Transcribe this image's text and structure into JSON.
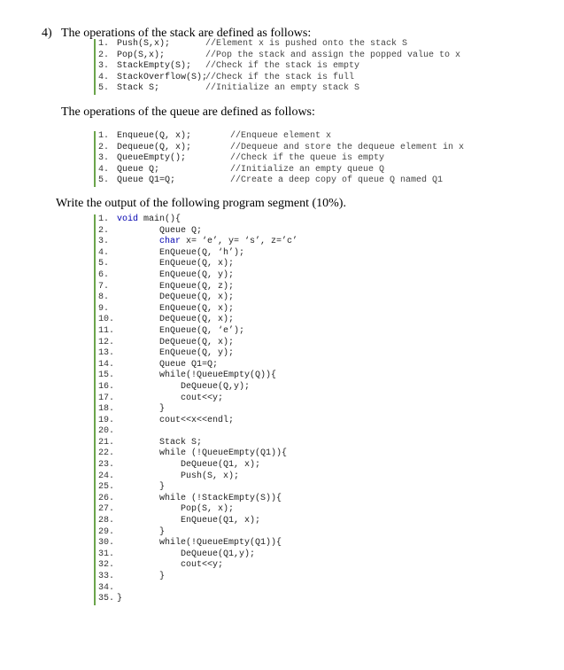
{
  "question": {
    "number": "4)",
    "stack_intro": "The operations of the stack are defined as follows:",
    "queue_intro": "The operations of the queue are defined as follows:",
    "task": "Write the output of the following program segment (10%)."
  },
  "stack_ops": [
    {
      "num": "1.",
      "code": "Push(S,x);",
      "comment": "//Element x is pushed onto the stack S"
    },
    {
      "num": "2.",
      "code": "Pop(S,x);",
      "comment": "//Pop the stack and assign the popped value to x"
    },
    {
      "num": "3.",
      "code": "StackEmpty(S);",
      "comment": "//Check if the stack is empty"
    },
    {
      "num": "4.",
      "code": "StackOverflow(S);",
      "comment": "//Check if the stack is full"
    },
    {
      "num": "5.",
      "code": "Stack S;",
      "comment": "//Initialize an empty stack S"
    }
  ],
  "queue_ops": [
    {
      "num": "1.",
      "code": "Enqueue(Q, x);",
      "comment": "//Enqueue element x"
    },
    {
      "num": "2.",
      "code": "Dequeue(Q, x);",
      "comment": "//Dequeue and store the dequeue element in x"
    },
    {
      "num": "3.",
      "code": "QueueEmpty();",
      "comment": "//Check if the queue is empty"
    },
    {
      "num": "4.",
      "code": "Queue Q;",
      "comment": "//Initialize an empty queue Q"
    },
    {
      "num": "5.",
      "code": "Queue Q1=Q;",
      "comment": "//Create a deep copy of queue Q named Q1"
    }
  ],
  "program": [
    {
      "num": "1.",
      "kw": "void",
      "text": " main(){"
    },
    {
      "num": "2.",
      "kw": "",
      "text": "        Queue Q;"
    },
    {
      "num": "3.",
      "kw": "        char",
      "text": " x= ‘e’, y= ‘s’, z=’c’"
    },
    {
      "num": "4.",
      "kw": "",
      "text": "        EnQueue(Q, ‘h’);"
    },
    {
      "num": "5.",
      "kw": "",
      "text": "        EnQueue(Q, x);"
    },
    {
      "num": "6.",
      "kw": "",
      "text": "        EnQueue(Q, y);"
    },
    {
      "num": "7.",
      "kw": "",
      "text": "        EnQueue(Q, z);"
    },
    {
      "num": "8.",
      "kw": "",
      "text": "        DeQueue(Q, x);"
    },
    {
      "num": "9.",
      "kw": "",
      "text": "        EnQueue(Q, x);"
    },
    {
      "num": "10.",
      "kw": "",
      "text": "        DeQueue(Q, x);"
    },
    {
      "num": "11.",
      "kw": "",
      "text": "        EnQueue(Q, ‘e’);"
    },
    {
      "num": "12.",
      "kw": "",
      "text": "        DeQueue(Q, x);"
    },
    {
      "num": "13.",
      "kw": "",
      "text": "        EnQueue(Q, y);"
    },
    {
      "num": "14.",
      "kw": "",
      "text": "        Queue Q1=Q;"
    },
    {
      "num": "15.",
      "kw": "",
      "text": "        while(!QueueEmpty(Q)){"
    },
    {
      "num": "16.",
      "kw": "",
      "text": "            DeQueue(Q,y);"
    },
    {
      "num": "17.",
      "kw": "",
      "text": "            cout<<y;"
    },
    {
      "num": "18.",
      "kw": "",
      "text": "        }"
    },
    {
      "num": "19.",
      "kw": "",
      "text": "        cout<<x<<endl;"
    },
    {
      "num": "20.",
      "kw": "",
      "text": ""
    },
    {
      "num": "21.",
      "kw": "",
      "text": "        Stack S;"
    },
    {
      "num": "22.",
      "kw": "",
      "text": "        while (!QueueEmpty(Q1)){"
    },
    {
      "num": "23.",
      "kw": "",
      "text": "            DeQueue(Q1, x);"
    },
    {
      "num": "24.",
      "kw": "",
      "text": "            Push(S, x);"
    },
    {
      "num": "25.",
      "kw": "",
      "text": "        }"
    },
    {
      "num": "26.",
      "kw": "",
      "text": "        while (!StackEmpty(S)){"
    },
    {
      "num": "27.",
      "kw": "",
      "text": "            Pop(S, x);"
    },
    {
      "num": "28.",
      "kw": "",
      "text": "            EnQueue(Q1, x);"
    },
    {
      "num": "29.",
      "kw": "",
      "text": "        }"
    },
    {
      "num": "30.",
      "kw": "",
      "text": "        while(!QueueEmpty(Q1)){"
    },
    {
      "num": "31.",
      "kw": "",
      "text": "            DeQueue(Q1,y);"
    },
    {
      "num": "32.",
      "kw": "",
      "text": "            cout<<y;"
    },
    {
      "num": "33.",
      "kw": "",
      "text": "        }"
    },
    {
      "num": "34.",
      "kw": "",
      "text": ""
    },
    {
      "num": "35.",
      "kw": "",
      "text": "}"
    }
  ]
}
